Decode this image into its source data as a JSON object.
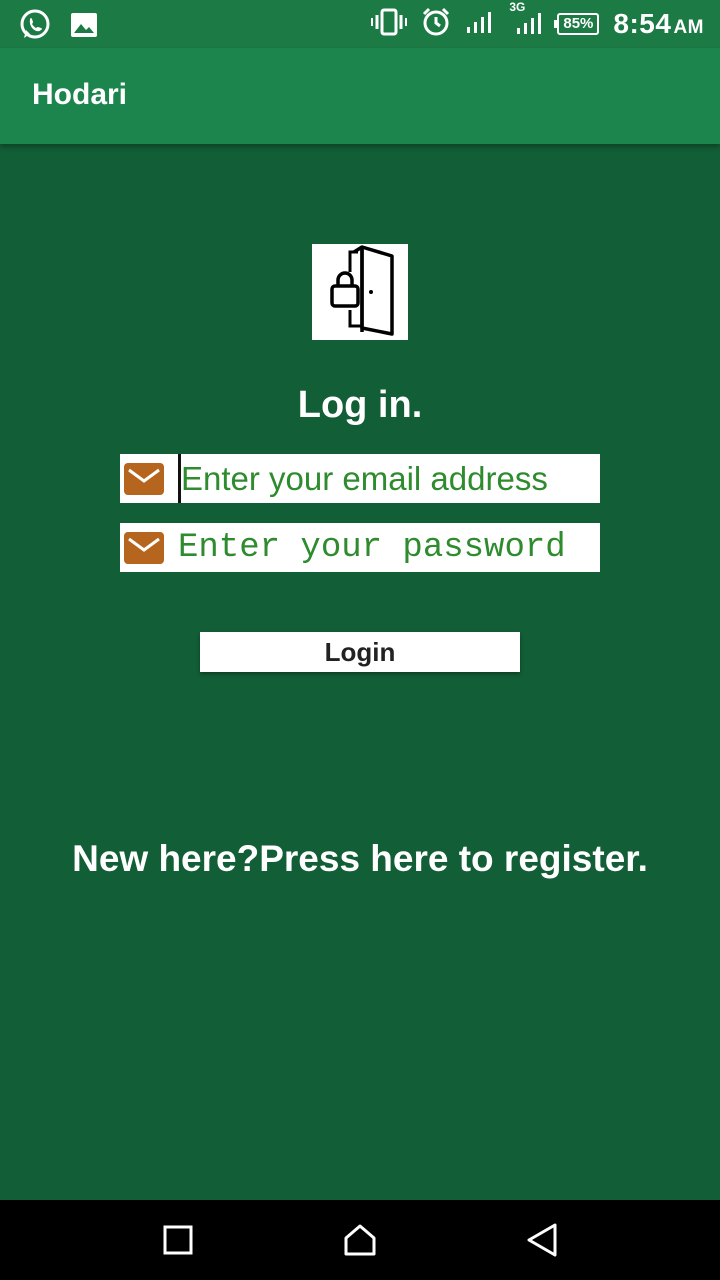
{
  "status_bar": {
    "icons_left": [
      "whatsapp-icon",
      "image-icon"
    ],
    "icons_right": [
      "vibrate-icon",
      "alarm-icon",
      "signal-icon",
      "signal-3g-icon"
    ],
    "network_label": "3G",
    "battery": "85%",
    "time": "8:54",
    "ampm": "AM"
  },
  "app_bar": {
    "title": "Hodari"
  },
  "login": {
    "logo_icon": "door-lock-icon",
    "heading": "Log in.",
    "email_placeholder": "Enter your email address",
    "email_icon": "mail-icon",
    "password_placeholder": "Enter your password",
    "password_icon": "mail-icon",
    "login_button": "Login",
    "register_text": "New here?Press here to register."
  },
  "nav_bar": {
    "buttons": [
      "recents-icon",
      "home-icon",
      "back-icon"
    ]
  },
  "colors": {
    "background": "#125e36",
    "app_bar": "#1c854d",
    "status_bar": "#1c7a45",
    "placeholder_text": "#2e8b2e",
    "field_icon": "#b5651d"
  }
}
